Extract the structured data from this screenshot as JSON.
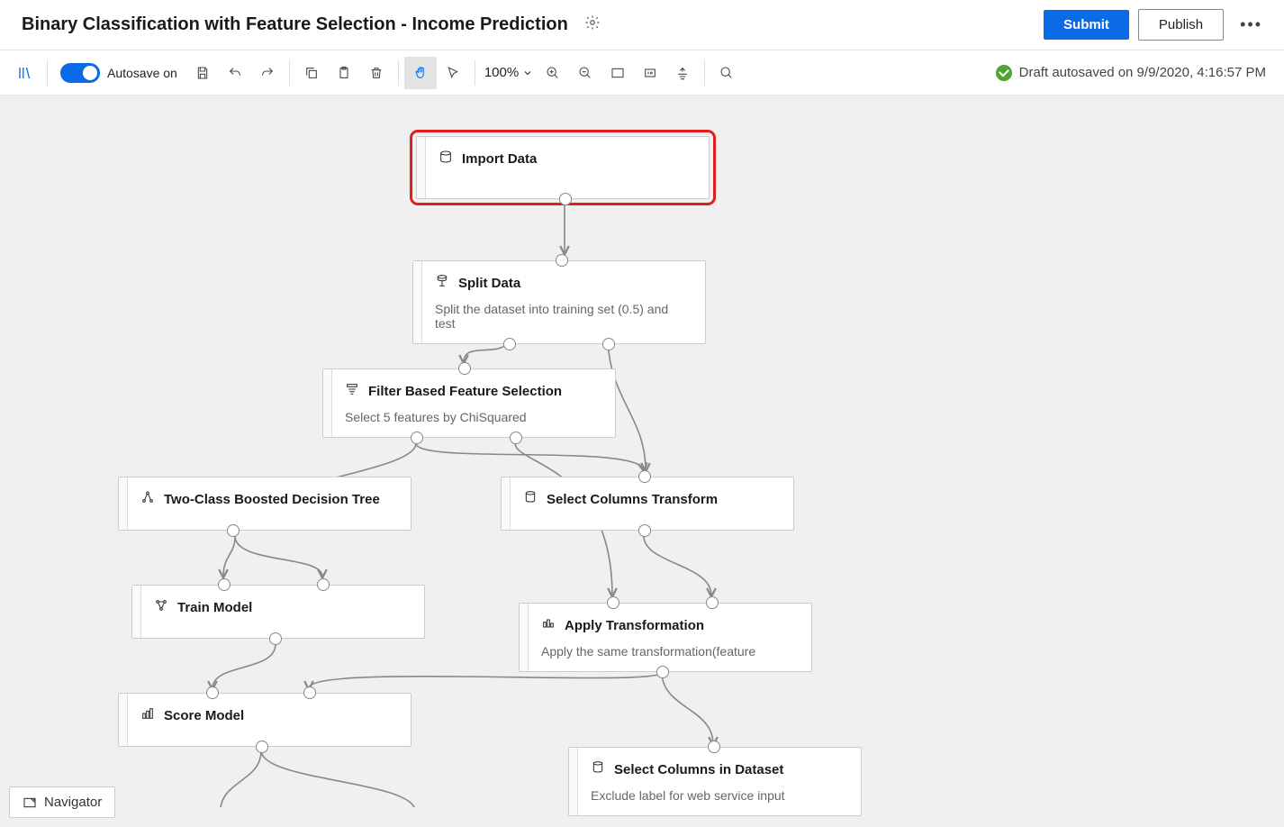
{
  "header": {
    "title": "Binary Classification with Feature Selection - Income Prediction",
    "submit": "Submit",
    "publish": "Publish"
  },
  "toolbar": {
    "autosave_label": "Autosave on",
    "zoom": "100%",
    "status": "Draft autosaved on 9/9/2020, 4:16:57 PM"
  },
  "nodes": {
    "import_data": {
      "title": "Import Data"
    },
    "split_data": {
      "title": "Split Data",
      "sub": "Split the dataset into training set (0.5) and test"
    },
    "fbfs": {
      "title": "Filter Based Feature Selection",
      "sub": "Select 5 features by ChiSquared"
    },
    "bdt": {
      "title": "Two-Class Boosted Decision Tree"
    },
    "select_cols_t": {
      "title": "Select Columns Transform"
    },
    "train_model": {
      "title": "Train Model"
    },
    "apply_trans": {
      "title": "Apply Transformation",
      "sub": "Apply the same transformation(feature"
    },
    "score_model": {
      "title": "Score Model"
    },
    "select_cols_ds": {
      "title": "Select Columns in Dataset",
      "sub": "Exclude label for web service input"
    }
  },
  "navigator": {
    "label": "Navigator"
  }
}
